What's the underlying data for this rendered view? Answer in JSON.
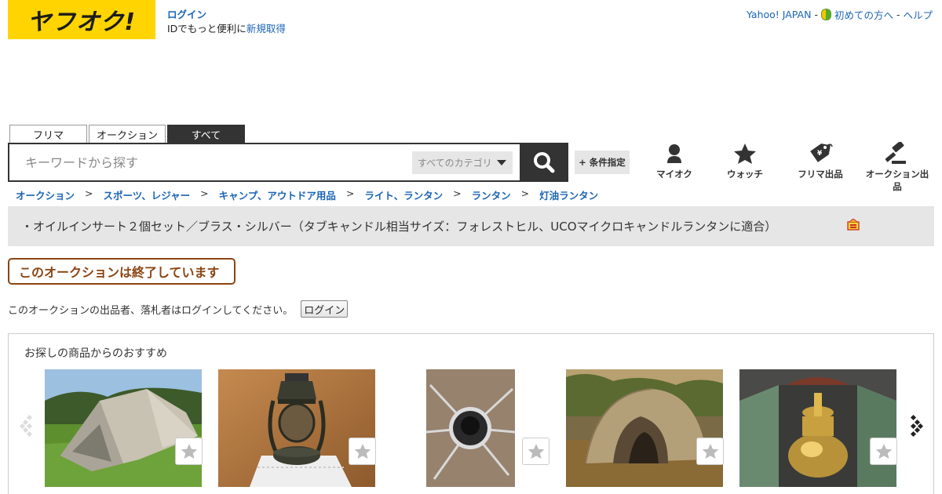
{
  "header": {
    "logo_text": "ヤフオク!",
    "login_link": "ログイン",
    "login_sub_prefix": "IDでもっと便利に",
    "signup_link": "新規取得",
    "top_links": {
      "yahoo": "Yahoo! JAPAN",
      "sep1": "-",
      "beginner": "初めての方へ",
      "sep2": "-",
      "help": "ヘルプ"
    }
  },
  "search": {
    "tabs": [
      "フリマ",
      "オークション",
      "すべて"
    ],
    "active_tab": "すべて",
    "placeholder": "キーワードから探す",
    "category_select": "すべてのカテゴリ",
    "conditions_button": "+ 条件指定"
  },
  "nav": {
    "myauc": "マイオク",
    "watch": "ウォッチ",
    "flea_sell": "フリマ出品",
    "auction_sell": "オークション出品"
  },
  "breadcrumb": {
    "items": [
      "オークション",
      "スポーツ、レジャー",
      "キャンプ、アウトドア用品",
      "ライト、ランタン",
      "ランタン",
      "灯油ランタン"
    ],
    "separator": ">"
  },
  "item": {
    "title": "・オイルインサート２個セット／ブラス・シルバー（タブキャンドル相当サイズ：フォレストヒル、UCOマイクロキャンドルランタンに適合）"
  },
  "status": {
    "ended_badge": "このオークションは終了しています",
    "login_prompt": "このオークションの出品者、落札者はログインしてください。",
    "login_button": "ログイン"
  },
  "recommend": {
    "title": "お探しの商品からのおすすめ",
    "items": [
      {
        "image": "tent-grey-photo"
      },
      {
        "image": "oil-lantern-photo"
      },
      {
        "image": "stove-burner-photo"
      },
      {
        "image": "tent-brown-photo"
      },
      {
        "image": "brass-stove-photo"
      }
    ]
  },
  "colors": {
    "brand_yellow": "#ffd400",
    "link_blue": "#1a64b5",
    "ended_brown": "#8b4513",
    "dark": "#333333"
  }
}
